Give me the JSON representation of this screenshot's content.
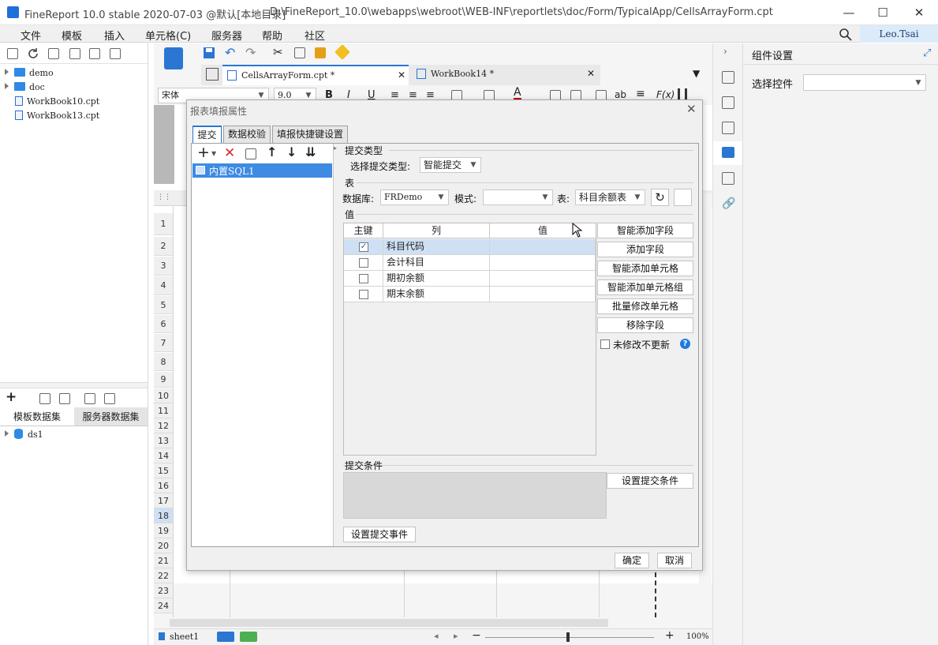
{
  "window": {
    "app_title": "FineReport 10.0 stable 2020-07-03 @默认[本地目录]",
    "file_path": "D:\\FineReport_10.0\\webapps\\webroot\\WEB-INF\\reportlets\\doc/Form/TypicalApp/CellsArrayForm.cpt",
    "minimize": "—",
    "maximize": "☐",
    "close": "✕"
  },
  "menubar": {
    "items": [
      "文件",
      "模板",
      "插入",
      "单元格(C)",
      "服务器",
      "帮助",
      "社区"
    ],
    "user": "Leo.Tsai"
  },
  "file_tree": {
    "items": [
      {
        "label": "demo",
        "type": "folder"
      },
      {
        "label": "doc",
        "type": "folder"
      },
      {
        "label": "WorkBook10.cpt",
        "type": "file"
      },
      {
        "label": "WorkBook13.cpt",
        "type": "file"
      }
    ]
  },
  "dataset_panel": {
    "tabs": [
      "模板数据集",
      "服务器数据集"
    ],
    "items": [
      "ds1"
    ]
  },
  "editor_tabs": [
    {
      "label": "CellsArrayForm.cpt *"
    },
    {
      "label": "WorkBook14 *"
    }
  ],
  "format_bar": {
    "font": "宋体",
    "size": "9.0"
  },
  "row_numbers": [
    "1",
    "2",
    "3",
    "4",
    "5",
    "6",
    "7",
    "8",
    "9",
    "10",
    "11",
    "12",
    "13",
    "14",
    "15",
    "16",
    "17",
    "18",
    "19",
    "20",
    "21",
    "22",
    "23",
    "24"
  ],
  "sheet_bar": {
    "sheet": "sheet1",
    "zoom": "100%",
    "minus": "−",
    "plus": "+"
  },
  "right_panel": {
    "title": "组件设置",
    "select_label": "选择控件"
  },
  "dialog": {
    "title": "报表填报属性",
    "tabs": [
      "提交",
      "数据校验",
      "填报快捷键设置"
    ],
    "submit_list": [
      "内置SQL1"
    ],
    "submit_type_section": "提交类型",
    "submit_type_label": "选择提交类型:",
    "submit_type_value": "智能提交",
    "table_section": "表",
    "db_label": "数据库:",
    "db_value": "FRDemo",
    "schema_label": "模式:",
    "schema_value": "",
    "table_label": "表:",
    "table_value": "科目余额表",
    "value_section": "值",
    "grid_headers": [
      "主键",
      "列",
      "值"
    ],
    "grid_rows": [
      {
        "key": true,
        "column": "科目代码",
        "value": ""
      },
      {
        "key": false,
        "column": "会计科目",
        "value": ""
      },
      {
        "key": false,
        "column": "期初余额",
        "value": ""
      },
      {
        "key": false,
        "column": "期末余额",
        "value": ""
      }
    ],
    "side_buttons": [
      "智能添加字段",
      "添加字段",
      "智能添加单元格",
      "智能添加单元格组",
      "批量修改单元格",
      "移除字段"
    ],
    "no_update_label": "未修改不更新",
    "condition_section": "提交条件",
    "set_condition": "设置提交条件",
    "set_event": "设置提交事件",
    "ok": "确定",
    "cancel": "取消"
  }
}
